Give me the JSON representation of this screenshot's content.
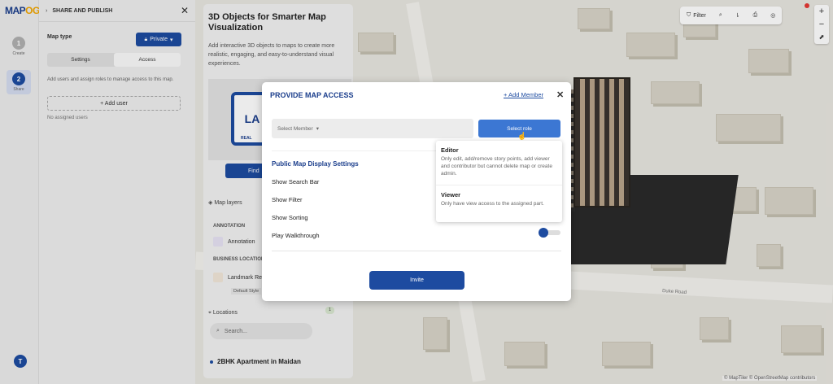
{
  "app": {
    "logo_main": "MAP",
    "logo_accent": "OG"
  },
  "steps": [
    {
      "num": "1",
      "label": "Create"
    },
    {
      "num": "2",
      "label": "Share"
    }
  ],
  "user_initial": "T",
  "share_panel": {
    "title": "SHARE AND PUBLISH",
    "map_type_label": "Map type",
    "map_type_value": "Private",
    "tabs": [
      "Settings",
      "Access"
    ],
    "access_desc": "Add users and assign roles to manage access to this map.",
    "add_user": "+ Add user",
    "no_users": "No assigned users"
  },
  "story_card": {
    "title": "3D Objects for Smarter Map Visualization",
    "desc": "Add interactive 3D objects to maps to create more realistic, engaging, and easy-to-understand visual experiences.",
    "logo_text": "LA",
    "logo_sub": "REAL",
    "find_btn": "Find",
    "map_layers": "Map layers",
    "annotation_label": "ANNOTATION",
    "annotation_item": "Annotation",
    "business_label": "BUSINESS LOCATION",
    "landmark_item": "Landmark Re",
    "default_style": "Default Style",
    "locations": "Locations",
    "locations_count": "1",
    "search_placeholder": "Search...",
    "place": "2BHK Apartment in Maidan"
  },
  "map_tools": {
    "filter": "Filter"
  },
  "map": {
    "road_label": "Duke Road",
    "attribution": "© MapTiler © OpenStreetMap contributors"
  },
  "modal": {
    "title": "PROVIDE MAP ACCESS",
    "add_member": "+ Add Member",
    "select_member": "Select Member",
    "select_role": "Select role",
    "settings_title": "Public Map Display Settings",
    "settings": [
      "Show Search Bar",
      "Show Filter",
      "Show Sorting",
      "Play Walkthrough"
    ],
    "invite": "Invite"
  },
  "roles": [
    {
      "name": "Editor",
      "desc": "Only edit, add/remove story points, add viewer and contributor but cannot delete map or create admin."
    },
    {
      "name": "Viewer",
      "desc": "Only have view access to the assigned part."
    }
  ],
  "colors": {
    "primary": "#1d4ba0",
    "accent": "#f0a500",
    "role_button": "#3c77d3"
  }
}
